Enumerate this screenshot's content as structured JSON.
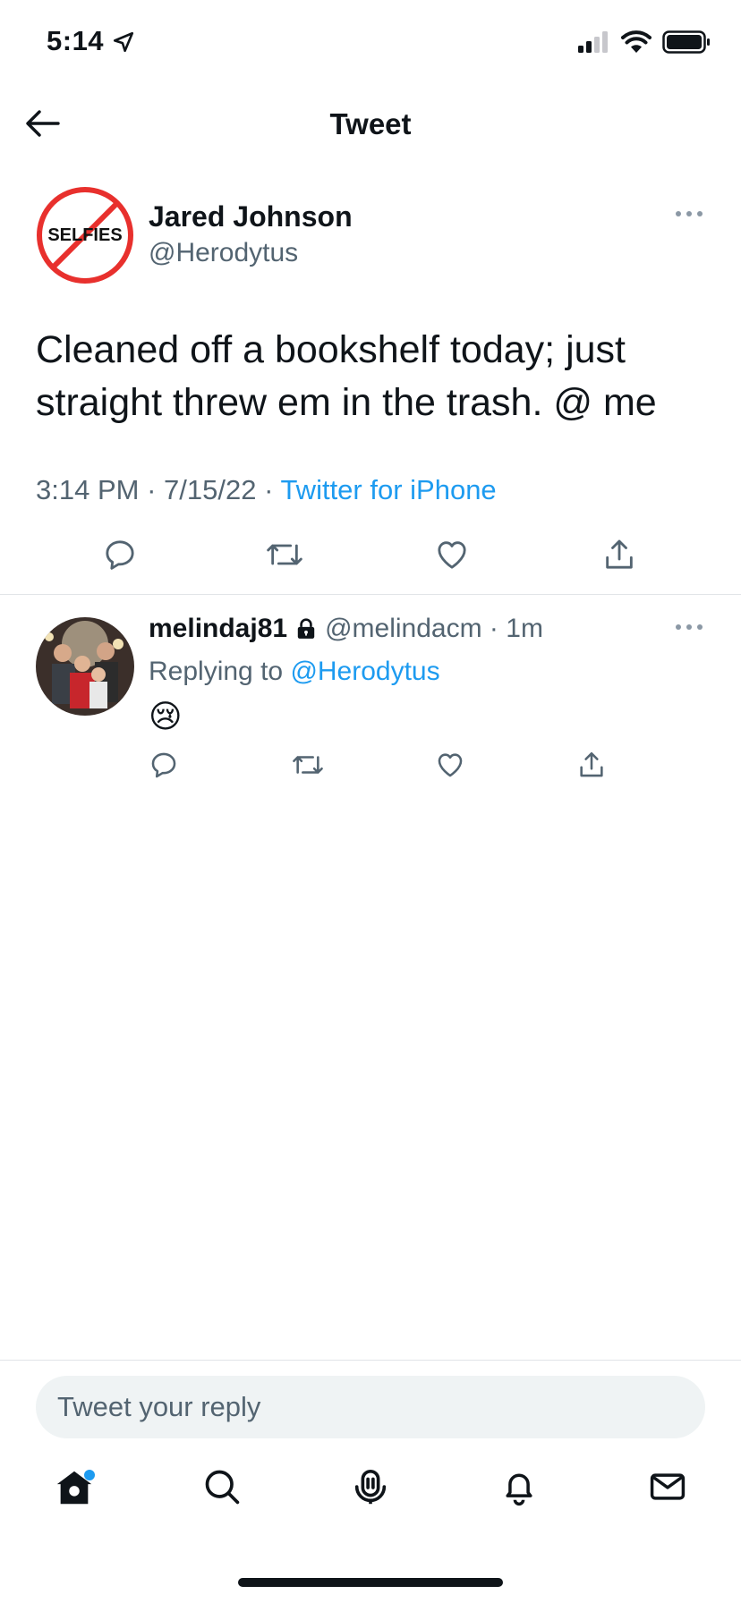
{
  "status_bar": {
    "time": "5:14"
  },
  "nav": {
    "title": "Tweet"
  },
  "main_tweet": {
    "avatar_text": "SELFIES",
    "author_name": "Jared Johnson",
    "author_handle": "@Herodytus",
    "text": "Cleaned off a bookshelf today; just straight threw em in the trash. @ me",
    "time": "3:14 PM",
    "date": "7/15/22",
    "source": "Twitter for iPhone"
  },
  "reply": {
    "author_name": "melindaj81",
    "author_handle": "@melindacm",
    "time_ago": "1m",
    "replying_prefix": "Replying to",
    "replying_to": "@Herodytus",
    "emoji": "😢"
  },
  "composer": {
    "placeholder": "Tweet your reply"
  },
  "colors": {
    "accent": "#1d9bf0",
    "text": "#0f1419",
    "muted": "#536471",
    "badge": "#e8302d"
  }
}
